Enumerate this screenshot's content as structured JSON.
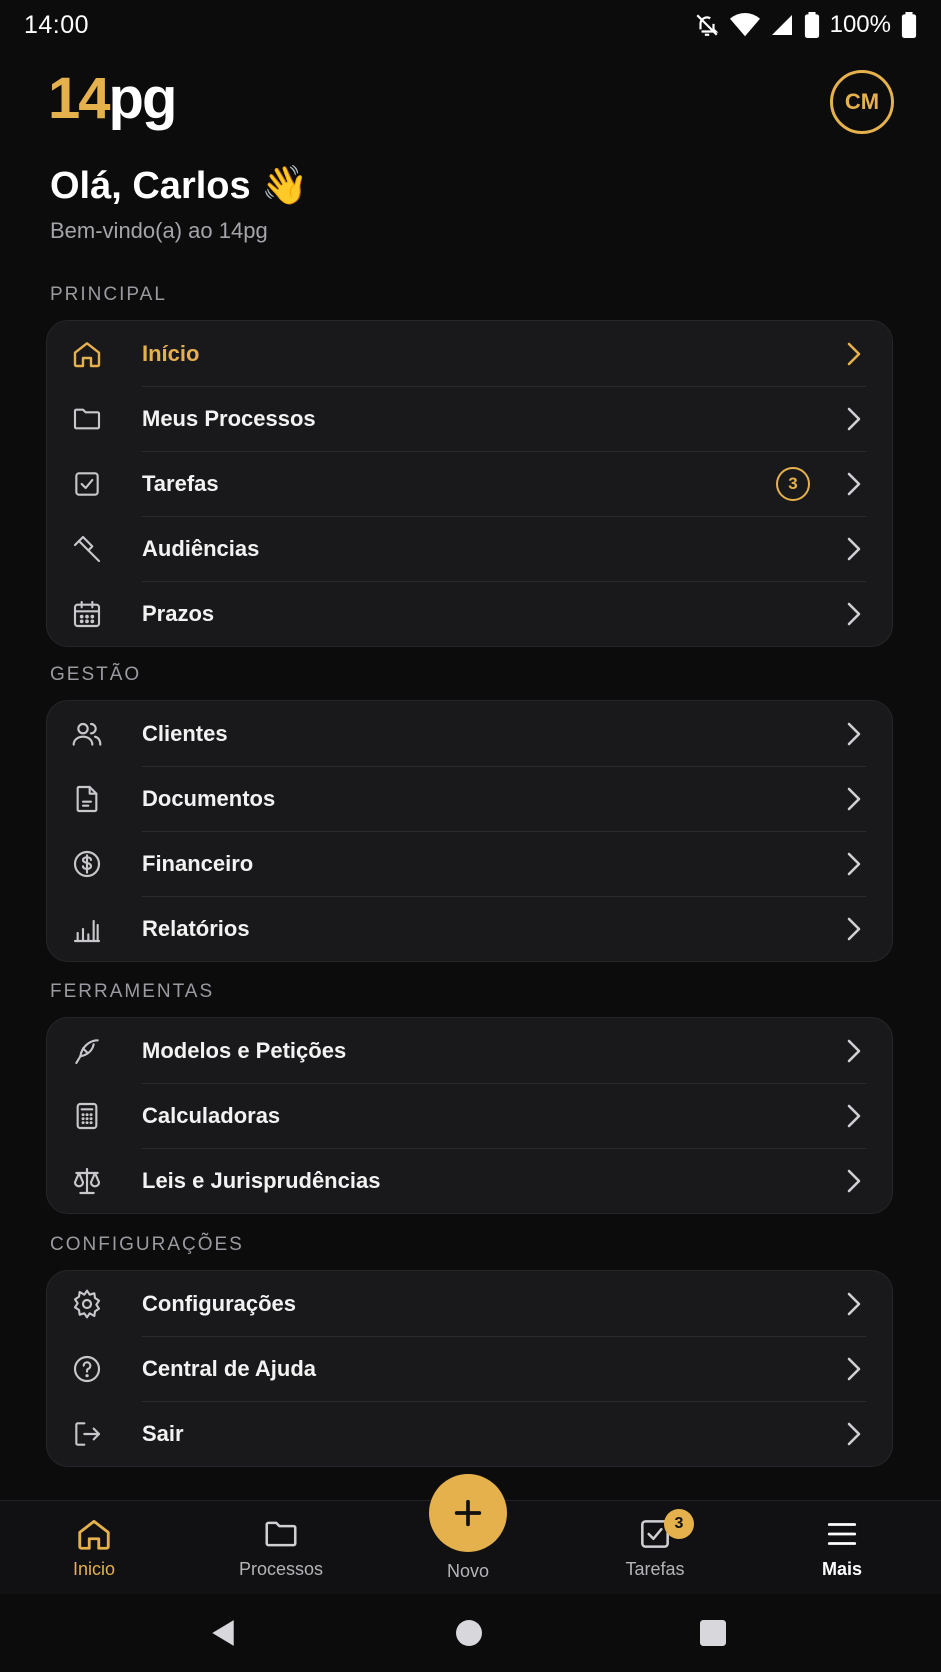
{
  "status_bar": {
    "time": "14:00",
    "battery": "100%"
  },
  "header": {
    "logo_number": "14",
    "logo_text": "pg",
    "avatar_initials": "CM"
  },
  "greeting": {
    "title": "Olá, Carlos 👋",
    "subtitle": "Bem-vindo(a) ao 14pg"
  },
  "sections": {
    "principal": {
      "label": "PRINCIPAL",
      "items": [
        {
          "label": "Início",
          "icon": "home-icon",
          "active": true
        },
        {
          "label": "Meus Processos",
          "icon": "folder-icon"
        },
        {
          "label": "Tarefas",
          "icon": "checkbox-icon",
          "badge": "3"
        },
        {
          "label": "Audiências",
          "icon": "gavel-icon"
        },
        {
          "label": "Prazos",
          "icon": "calendar-icon"
        }
      ]
    },
    "gestao": {
      "label": "GESTÃO",
      "items": [
        {
          "label": "Clientes",
          "icon": "users-icon"
        },
        {
          "label": "Documentos",
          "icon": "document-icon"
        },
        {
          "label": "Financeiro",
          "icon": "dollar-icon"
        },
        {
          "label": "Relatórios",
          "icon": "bar-chart-icon"
        }
      ]
    },
    "ferramentas": {
      "label": "FERRAMENTAS",
      "items": [
        {
          "label": "Modelos e Petições",
          "icon": "pen-icon"
        },
        {
          "label": "Calculadoras",
          "icon": "calculator-icon"
        },
        {
          "label": "Leis e Jurisprudências",
          "icon": "scale-icon"
        }
      ]
    },
    "configuracoes": {
      "label": "CONFIGURAÇÕES",
      "items": [
        {
          "label": "Configurações",
          "icon": "gear-icon"
        },
        {
          "label": "Central de Ajuda",
          "icon": "help-icon"
        },
        {
          "label": "Sair",
          "icon": "logout-icon"
        }
      ]
    }
  },
  "bottom_nav": {
    "inicio": "Inicio",
    "processos": "Processos",
    "novo": "Novo",
    "tarefas": "Tarefas",
    "tarefas_badge": "3",
    "mais": "Mais"
  },
  "colors": {
    "accent": "#e5b14c",
    "background": "#0c0c0d",
    "card": "#19191b"
  }
}
